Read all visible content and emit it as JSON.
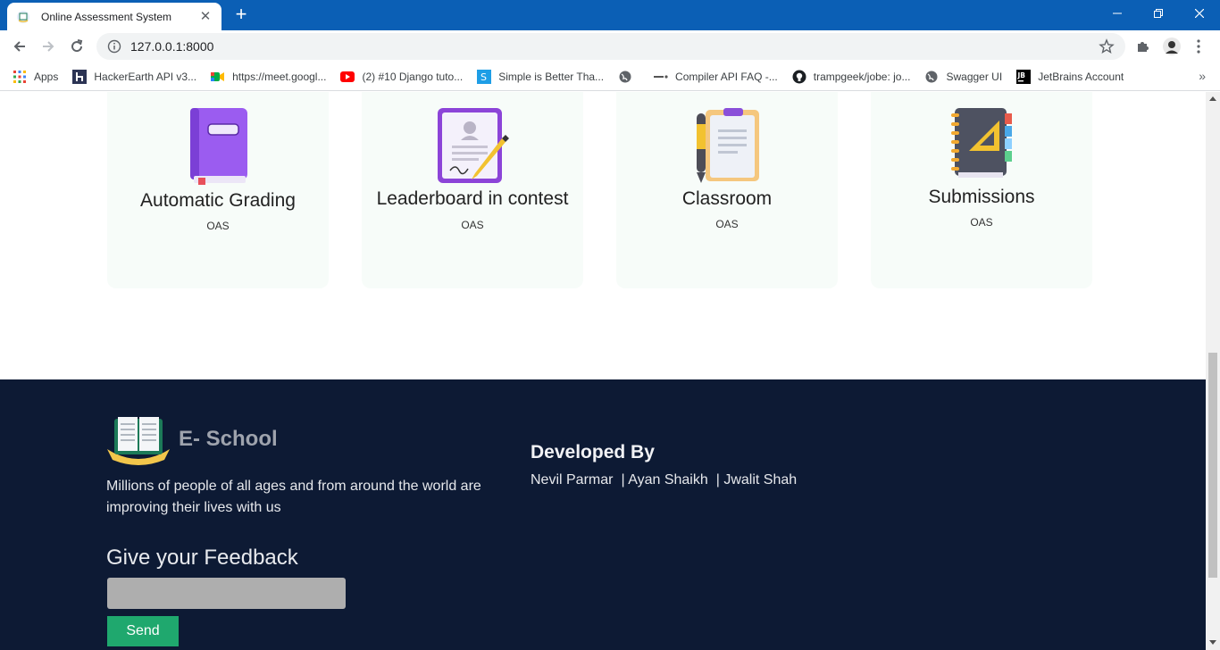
{
  "browser": {
    "tab_title": "Online Assessment System",
    "url": "127.0.0.1:8000",
    "bookmarks": [
      {
        "label": "Apps",
        "icon": "apps-grid-icon"
      },
      {
        "label": "HackerEarth API v3...",
        "icon": "hackerearth-icon"
      },
      {
        "label": "https://meet.googl...",
        "icon": "google-meet-icon"
      },
      {
        "label": "(2) #10 Django tuto...",
        "icon": "youtube-icon"
      },
      {
        "label": "Simple is Better Tha...",
        "icon": "simple-better-icon"
      },
      {
        "label": "",
        "icon": "globe-icon"
      },
      {
        "label": "Compiler API FAQ -...",
        "icon": "compiler-icon"
      },
      {
        "label": "trampgeek/jobe: jo...",
        "icon": "github-icon"
      },
      {
        "label": "Swagger UI",
        "icon": "globe-icon"
      },
      {
        "label": "JetBrains Account",
        "icon": "jetbrains-icon"
      }
    ],
    "accent": "#0b5fb5"
  },
  "features": [
    {
      "title": "Automatic Grading",
      "subtitle": "OAS",
      "icon": "book-icon"
    },
    {
      "title": "Leaderboard in contest",
      "subtitle": "OAS",
      "icon": "certificate-icon"
    },
    {
      "title": "Classroom",
      "subtitle": "OAS",
      "icon": "clipboard-pen-icon"
    },
    {
      "title": "Submissions",
      "subtitle": "OAS",
      "icon": "notebook-icon"
    }
  ],
  "footer": {
    "brand": "E- School",
    "tagline": "Millions of people of all ages and from around the world are improving their lives with us",
    "feedback_title": "Give your Feedback",
    "feedback_placeholder": "",
    "send_label": "Send",
    "developed_by": "Developed By",
    "developers": [
      "Nevil Parmar",
      "| Ayan Shaikh",
      "| Jwalit Shah"
    ],
    "background": "#0d1a34",
    "send_color": "#1fa86e"
  }
}
